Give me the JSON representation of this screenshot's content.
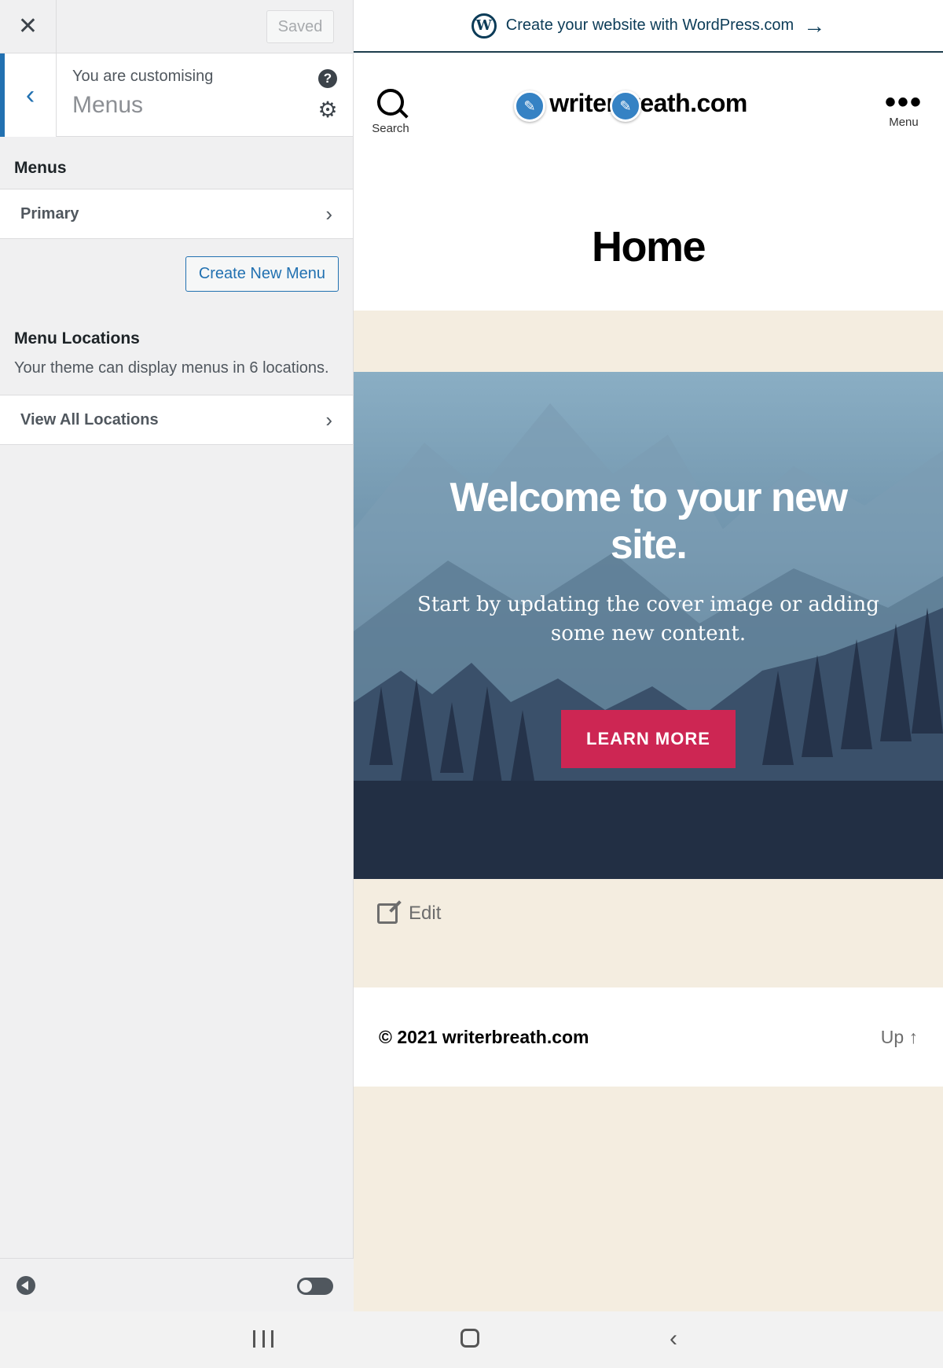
{
  "customizer": {
    "close_icon": "close-icon",
    "saved_label": "Saved",
    "customising_label": "You are customising",
    "section_name": "Menus",
    "menus_heading": "Menus",
    "primary_menu": "Primary",
    "create_menu_label": "Create New Menu",
    "locations_heading": "Menu Locations",
    "locations_description": "Your theme can display menus in 6 locations.",
    "view_locations_label": "View All Locations",
    "accent_color": "#2271b1"
  },
  "preview": {
    "promo_text": "Create your website with WordPress.com",
    "search_label": "Search",
    "site_title": "writerbreath.com",
    "menu_label": "Menu",
    "page_title": "Home",
    "hero_heading": "Welcome to your new site.",
    "hero_text": "Start by updating the cover image or adding some new content.",
    "hero_button": "LEARN MORE",
    "edit_label": "Edit",
    "copyright": "© 2021 writerbreath.com",
    "up_label": "Up ↑",
    "button_color": "#cd2653",
    "background_color": "#f4ede0"
  }
}
